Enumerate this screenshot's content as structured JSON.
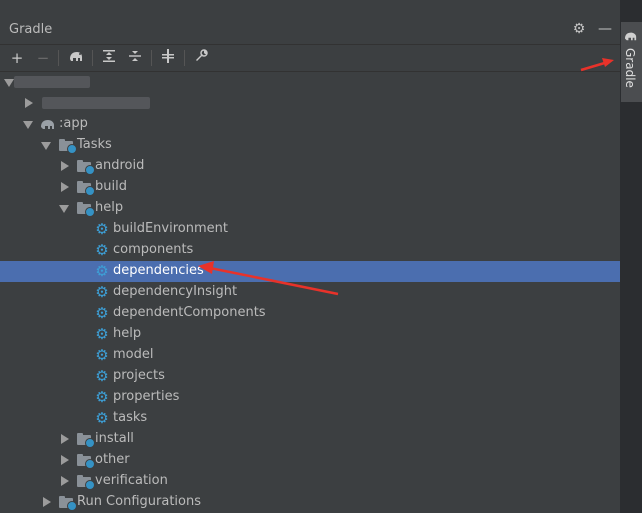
{
  "panel": {
    "title": "Gradle"
  },
  "side_tab": {
    "label": "Gradle"
  },
  "toolbar": {
    "add": "+",
    "remove": "−",
    "expand_all": "⇕",
    "collapse_all": "⇕",
    "toggle_offline": "⫲",
    "settings": "🔧"
  },
  "tree": {
    "root": {
      "label": ""
    },
    "module_blurred": {
      "label": ""
    },
    "app": {
      "label": ":app"
    },
    "tasks": {
      "label": "Tasks"
    },
    "android": {
      "label": "android"
    },
    "build": {
      "label": "build"
    },
    "help": {
      "label": "help"
    },
    "help_tasks": [
      "buildEnvironment",
      "components",
      "dependencies",
      "dependencyInsight",
      "dependentComponents",
      "help",
      "model",
      "projects",
      "properties",
      "tasks"
    ],
    "install": {
      "label": "install"
    },
    "other": {
      "label": "other"
    },
    "verification": {
      "label": "verification"
    },
    "run_configurations": {
      "label": "Run Configurations"
    }
  },
  "colors": {
    "selection": "#4b6eaf",
    "annotation_arrow": "#e8322a",
    "gear": "#3d9fd6"
  }
}
